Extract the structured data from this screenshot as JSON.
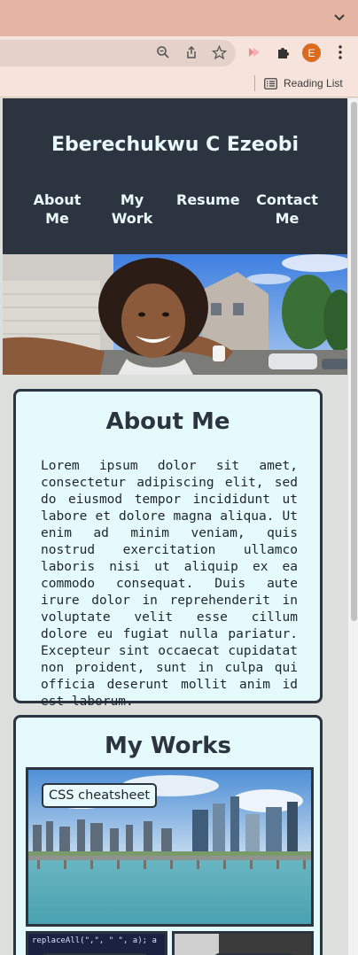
{
  "browser": {
    "profile_initial": "E",
    "reading_list_label": "Reading List",
    "icons": [
      "chevron-down-icon",
      "zoom-icon",
      "share-icon",
      "star-icon",
      "extension-icon",
      "puzzle-icon",
      "more-icon"
    ]
  },
  "site": {
    "title": "Eberechukwu C Ezeobi",
    "nav": [
      {
        "label_line1": "About",
        "label_line2": "Me"
      },
      {
        "label_line1": "My",
        "label_line2": "Work"
      },
      {
        "label_line1": "Resume",
        "label_line2": ""
      },
      {
        "label_line1": "Contact",
        "label_line2": "Me"
      }
    ]
  },
  "about": {
    "heading": "About Me",
    "body": "Lorem ipsum dolor sit amet, consectetur adipiscing elit, sed do eiusmod tempor incididunt ut labore et dolore magna aliqua. Ut enim ad minim veniam, quis nostrud exercitation ullamco laboris nisi ut aliquip ex ea commodo consequat. Duis aute irure dolor in reprehenderit in voluptate velit esse cillum dolore eu fugiat nulla pariatur. Excepteur sint occaecat cupidatat non proident, sunt in culpa qui officia deserunt mollit anim id est laborum."
  },
  "works": {
    "heading": "My Works",
    "featured_label": "CSS cheatsheet",
    "code_snippet": "replaceAll(\",\", \" \", a); a"
  }
}
